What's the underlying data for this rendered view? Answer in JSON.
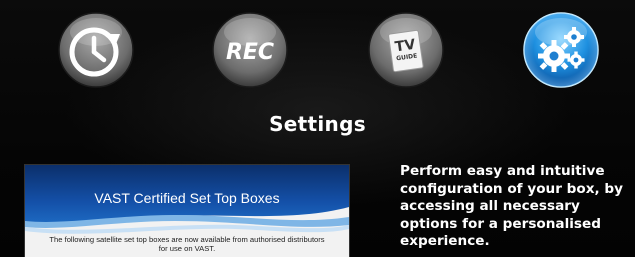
{
  "menu": {
    "items": [
      {
        "icon": "clock-icon"
      },
      {
        "icon": "rec-icon",
        "label": "REC"
      },
      {
        "icon": "tv-guide-icon",
        "label_top": "TV",
        "label_bottom": "GUIDE"
      },
      {
        "icon": "gears-icon",
        "selected": true
      }
    ]
  },
  "section": {
    "title": "Settings",
    "description": "Perform easy and intuitive configuration of your box, by accessing all necessary options for a personalised experience."
  },
  "preview": {
    "heading": "VAST Certified Set Top Boxes",
    "body": "The following satellite set top boxes are now available from authorised distributors for use on VAST."
  },
  "colors": {
    "accent": "#1e90e0",
    "background": "#050505",
    "preview_band": "#0d3f8a"
  }
}
